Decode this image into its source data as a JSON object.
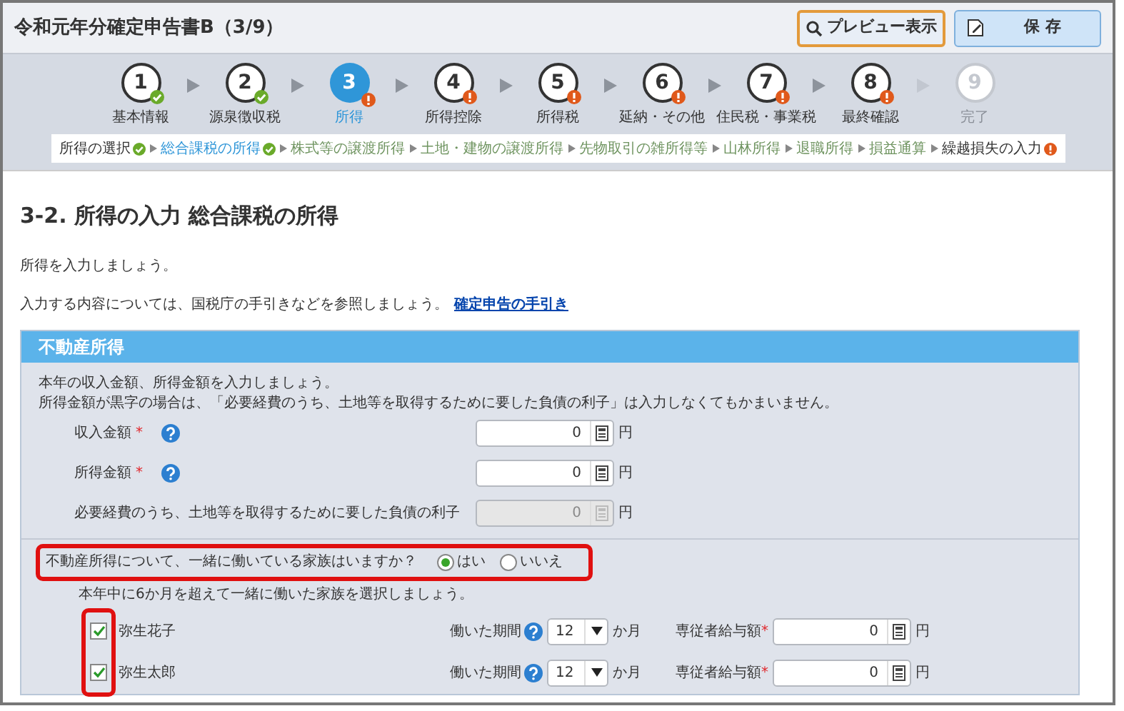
{
  "window": {
    "title": "令和元年分確定申告書B（3/9）"
  },
  "toolbar": [
    {
      "kind": "preview",
      "label": "プレビュー表示"
    },
    {
      "kind": "save",
      "label": "保 存"
    }
  ],
  "steps": [
    {
      "number": "1",
      "label": "基本情報",
      "selected": false,
      "completed": true,
      "warning": false,
      "disabled": false
    },
    {
      "number": "2",
      "label": "源泉徴収税",
      "selected": false,
      "completed": true,
      "warning": false,
      "disabled": false
    },
    {
      "number": "3",
      "label": "所得",
      "selected": true,
      "completed": false,
      "warning": true,
      "disabled": false
    },
    {
      "number": "4",
      "label": "所得控除",
      "selected": false,
      "completed": false,
      "warning": true,
      "disabled": false
    },
    {
      "number": "5",
      "label": "所得税",
      "selected": false,
      "completed": false,
      "warning": true,
      "disabled": false
    },
    {
      "number": "6",
      "label": "延納・その他",
      "selected": false,
      "completed": false,
      "warning": true,
      "disabled": false
    },
    {
      "number": "7",
      "label": "住民税・事業税",
      "selected": false,
      "completed": false,
      "warning": true,
      "disabled": false
    },
    {
      "number": "8",
      "label": "最終確認",
      "selected": false,
      "completed": false,
      "warning": true,
      "disabled": false
    },
    {
      "number": "9",
      "label": "完了",
      "selected": false,
      "completed": false,
      "warning": false,
      "disabled": true
    }
  ],
  "subnav": [
    {
      "label": "所得の選択",
      "selected": false,
      "completed": true,
      "warning": false
    },
    {
      "label": "総合課税の所得",
      "selected": true,
      "completed": true,
      "warning": false
    },
    {
      "label": "株式等の譲渡所得",
      "selected": false,
      "completed": false,
      "warning": false
    },
    {
      "label": "土地・建物の譲渡所得",
      "selected": false,
      "completed": false,
      "warning": false
    },
    {
      "label": "先物取引の雑所得等",
      "selected": false,
      "completed": false,
      "warning": false
    },
    {
      "label": "山林所得",
      "selected": false,
      "completed": false,
      "warning": false
    },
    {
      "label": "退職所得",
      "selected": false,
      "completed": false,
      "warning": false
    },
    {
      "label": "損益通算",
      "selected": false,
      "completed": false,
      "warning": false
    },
    {
      "label": "繰越損失の入力",
      "selected": false,
      "completed": false,
      "warning": true
    }
  ],
  "page": {
    "heading": "3-2. 所得の入力 総合課税の所得",
    "intro": "所得を入力しましょう。",
    "guide_text": "入力する内容については、国税庁の手引きなどを参照しましょう。",
    "guide_link": "確定申告の手引き"
  },
  "section": {
    "title": "不動産所得",
    "notes": [
      "本年の収入金額、所得金額を入力しましょう。",
      "所得金額が黒字の場合は、「必要経費のうち、土地等を取得するために要した負債の利子」は入力しなくてもかまいません。"
    ],
    "fields": [
      {
        "label": "収入金額",
        "required_mark": "*",
        "help": true,
        "value": "0",
        "unit": "円",
        "disabled": false
      },
      {
        "label": "所得金額",
        "required_mark": "*",
        "help": true,
        "value": "0",
        "unit": "円",
        "disabled": false
      },
      {
        "label": "必要経費のうち、土地等を取得するために要した負債の利子",
        "help": false,
        "value": "0",
        "unit": "円",
        "disabled": true
      }
    ],
    "question": {
      "text": "不動産所得について、一緒に働いている家族はいますか？",
      "options": [
        {
          "label": "はい",
          "selected": true
        },
        {
          "label": "いいえ",
          "selected": false
        }
      ]
    },
    "family_hint": "本年中に6か月を超えて一緒に働いた家族を選択しましょう。",
    "family": [
      {
        "name": "弥生花子",
        "checked": true,
        "period_label": "働いた期間",
        "period": "12",
        "period_unit": "か月",
        "salary_label": "専従者給与額",
        "salary_required_mark": "*",
        "salary": "0",
        "salary_unit": "円"
      },
      {
        "name": "弥生太郎",
        "checked": true,
        "period_label": "働いた期間",
        "period": "12",
        "period_unit": "か月",
        "salary_label": "専従者給与額",
        "salary_required_mark": "*",
        "salary": "0",
        "salary_unit": "円"
      }
    ]
  }
}
